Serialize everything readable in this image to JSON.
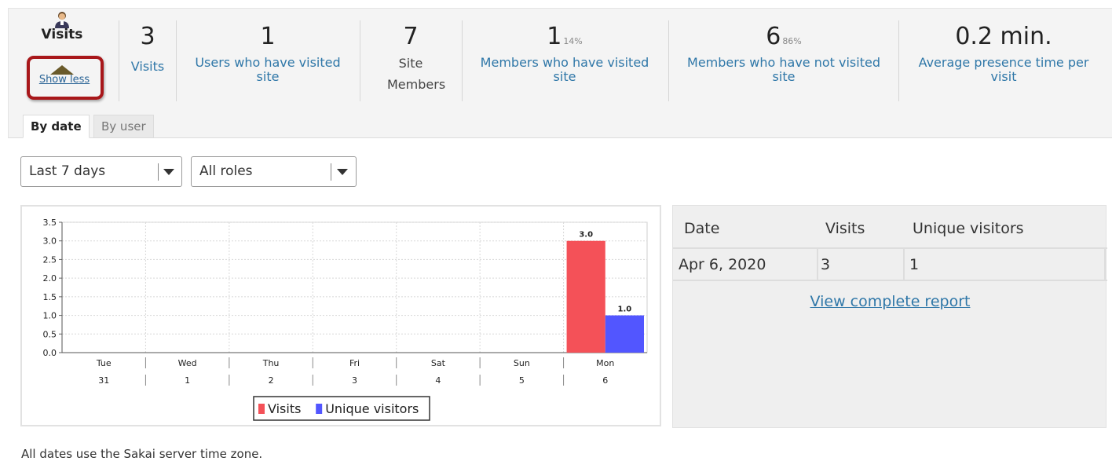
{
  "header": {
    "visits_title": "Visits",
    "show_less": "Show less",
    "stats": [
      {
        "value": "3",
        "pct": "",
        "label": "Visits"
      },
      {
        "value": "1",
        "pct": "",
        "label": "Users who have visited site"
      },
      {
        "value": "7",
        "pct": "",
        "label": "Site Members"
      },
      {
        "value": "1",
        "pct": "14%",
        "label": "Members who have visited site"
      },
      {
        "value": "6",
        "pct": "86%",
        "label": "Members who have not visited site"
      },
      {
        "value": "0.2 min.",
        "pct": "",
        "label": "Average presence time per visit"
      }
    ]
  },
  "tabs": [
    {
      "label": "By date",
      "active": true
    },
    {
      "label": "By user",
      "active": false
    }
  ],
  "filters": {
    "period": "Last 7 days",
    "role": "All roles"
  },
  "chart_data": {
    "type": "bar",
    "categories": [
      "Tue 31",
      "Wed 1",
      "Thu 2",
      "Fri 3",
      "Sat 4",
      "Sun 5",
      "Mon 6"
    ],
    "x_day_names": [
      "Tue",
      "Wed",
      "Thu",
      "Fri",
      "Sat",
      "Sun",
      "Mon"
    ],
    "x_day_nums": [
      "31",
      "1",
      "2",
      "3",
      "4",
      "5",
      "6"
    ],
    "series": [
      {
        "name": "Visits",
        "color": "#f45158",
        "values": [
          0,
          0,
          0,
          0,
          0,
          0,
          3.0
        ]
      },
      {
        "name": "Unique visitors",
        "color": "#5256ff",
        "values": [
          0,
          0,
          0,
          0,
          0,
          0,
          1.0
        ]
      }
    ],
    "data_labels": [
      {
        "series": 0,
        "index": 6,
        "text": "3.0"
      },
      {
        "series": 1,
        "index": 6,
        "text": "1.0"
      }
    ],
    "yticks": [
      "0.0",
      "0.5",
      "1.0",
      "1.5",
      "2.0",
      "2.5",
      "3.0",
      "3.5"
    ],
    "ylim": [
      0,
      3.5
    ],
    "grid": true,
    "legend": "bottom-center"
  },
  "table": {
    "headers": [
      "Date",
      "Visits",
      "Unique visitors"
    ],
    "rows": [
      [
        "Apr 6, 2020",
        "3",
        "1"
      ]
    ],
    "link": "View complete report"
  },
  "footnote": "All dates use the Sakai server time zone."
}
